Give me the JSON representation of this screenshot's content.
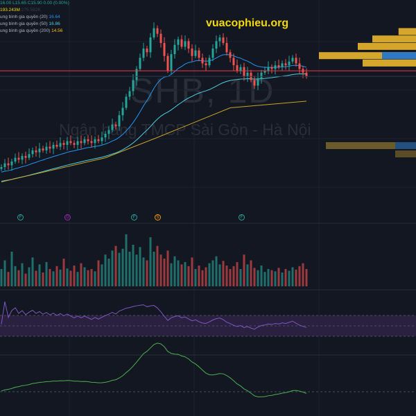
{
  "header": {
    "ohlc": "16.00  L15.65  C15.90  0.00 (0.00%)",
    "volume": "193.243M",
    "volume_extra": "275.592K",
    "ma": [
      {
        "label": "ung bình gia quyền (20)",
        "value": "16.64",
        "color": "#2196f3"
      },
      {
        "label": "ung bình gia quyền (50)",
        "value": "16.86",
        "color": "#4dd0e1"
      },
      {
        "label": "ung bình gia quyền (200)",
        "value": "14.56",
        "color": "#ffc107"
      }
    ]
  },
  "watermark": {
    "symbol": "SHB, 1D",
    "name": "Ngân hàng TMCP Sài Gòn - Hà Nội"
  },
  "brand": "vuacophieu.org",
  "events": [
    {
      "label": "F",
      "color": "#26a69a"
    },
    {
      "label": "D",
      "color": "#9c27b0"
    },
    {
      "label": "F",
      "color": "#26a69a"
    },
    {
      "label": "S",
      "color": "#ff9800"
    },
    {
      "label": "F",
      "color": "#26a69a"
    }
  ],
  "chart_data": {
    "type": "candlestick",
    "symbol": "SHB",
    "interval": "1D",
    "ylim": [
      10.1,
      18.9
    ],
    "closes": [
      11.0,
      11.2,
      11.1,
      11.3,
      11.5,
      11.4,
      11.6,
      11.5,
      11.7,
      11.9,
      11.8,
      12.0,
      11.9,
      12.1,
      12.0,
      12.2,
      12.1,
      12.3,
      12.2,
      12.4,
      12.3,
      12.2,
      12.4,
      12.3,
      12.5,
      12.4,
      12.3,
      12.5,
      12.4,
      12.6,
      12.8,
      13.0,
      13.3,
      13.2,
      13.8,
      14.2,
      14.8,
      15.1,
      15.7,
      16.3,
      16.9,
      17.4,
      17.2,
      18.0,
      18.5,
      18.2,
      17.7,
      17.0,
      16.2,
      17.1,
      17.6,
      17.9,
      17.5,
      17.8,
      17.4,
      17.0,
      17.3,
      16.9,
      16.6,
      16.5,
      16.9,
      17.4,
      17.8,
      18.0,
      17.7,
      17.2,
      16.9,
      16.5,
      16.2,
      16.4,
      15.9,
      16.1,
      15.7,
      15.4,
      15.8,
      16.1,
      16.2,
      16.4,
      16.3,
      16.5,
      16.4,
      16.6,
      16.5,
      16.7,
      16.9,
      16.6,
      16.3,
      16.1,
      15.9
    ],
    "volumes": [
      30,
      45,
      25,
      60,
      35,
      28,
      40,
      22,
      33,
      50,
      27,
      38,
      24,
      42,
      30,
      26,
      35,
      29,
      48,
      31,
      27,
      36,
      25,
      40,
      33,
      28,
      30,
      26,
      45,
      38,
      55,
      48,
      62,
      70,
      58,
      65,
      90,
      60,
      72,
      55,
      68,
      50,
      45,
      85,
      60,
      70,
      55,
      48,
      62,
      40,
      52,
      45,
      38,
      42,
      35,
      50,
      30,
      36,
      28,
      33,
      40,
      45,
      52,
      38,
      44,
      36,
      30,
      35,
      42,
      30,
      55,
      38,
      45,
      32,
      28,
      36,
      25,
      30,
      28,
      26,
      32,
      24,
      30,
      27,
      33,
      29,
      35,
      40,
      30
    ],
    "ma200": [
      [
        0,
        10.2
      ],
      [
        30,
        11.5
      ],
      [
        45,
        12.6
      ],
      [
        66,
        14.2
      ],
      [
        88,
        14.56
      ]
    ],
    "hline_price": 16.2,
    "volume_profile": [
      {
        "price": 18.3,
        "size": 0.18,
        "up": 0
      },
      {
        "price": 17.9,
        "size": 0.45,
        "up": 0
      },
      {
        "price": 17.5,
        "size": 0.6,
        "up": 0
      },
      {
        "price": 17.0,
        "size": 1.0,
        "up": 0.35
      },
      {
        "price": 16.6,
        "size": 0.55,
        "up": 0
      }
    ],
    "up_color": "#26a69a",
    "down_color": "#ef5350"
  }
}
